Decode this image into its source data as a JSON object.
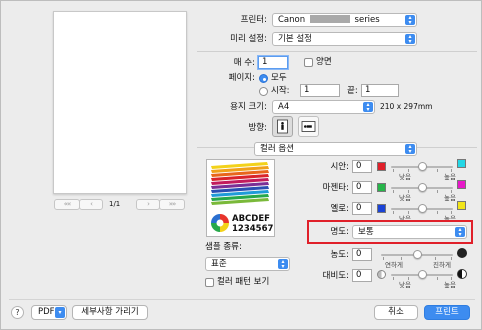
{
  "printer": {
    "label": "프린터:",
    "value": "Canon",
    "series": "series"
  },
  "presets": {
    "label": "미리 설정:",
    "value": "기본 설정"
  },
  "copies": {
    "label": "매 수:",
    "value": "1",
    "duplex_label": "양면"
  },
  "pages": {
    "label": "페이지:",
    "all_label": "모두",
    "from_label": "시작:",
    "from_value": "1",
    "to_label": "끝:",
    "to_value": "1"
  },
  "paper": {
    "label": "용지 크기:",
    "value": "A4",
    "dimensions": "210 x 297mm"
  },
  "orientation": {
    "label": "방향:"
  },
  "pager": {
    "page_indicator": "1/1"
  },
  "section": {
    "value": "컬러 옵션"
  },
  "sample": {
    "logo_line1": "ABCDEF",
    "logo_line2": "1234567",
    "type_label": "샘플 종류:",
    "type_value": "표준",
    "pattern_label": "컬러 패턴 보기"
  },
  "color": {
    "cyan_label": "시안:",
    "cyan_value": "0",
    "magenta_label": "마젠타:",
    "magenta_value": "0",
    "yellow_label": "옐로:",
    "yellow_value": "0",
    "low": "낮음",
    "high": "높음"
  },
  "brightness": {
    "label": "명도:",
    "value": "보통"
  },
  "intensity": {
    "label": "농도:",
    "value": "0",
    "low": "연하게",
    "high": "진하게"
  },
  "contrast": {
    "label": "대비도:",
    "value": "0",
    "low": "낮음",
    "high": "높음"
  },
  "footer": {
    "help": "?",
    "pdf": "PDF",
    "details": "세부사항 가리기",
    "cancel": "취소",
    "print": "프린트"
  },
  "colors": {
    "accent": "#3d8cf0",
    "highlight": "#e0202a",
    "cyan": "#23d7e6",
    "magenta": "#e818c9",
    "yellow": "#f2e51a"
  }
}
